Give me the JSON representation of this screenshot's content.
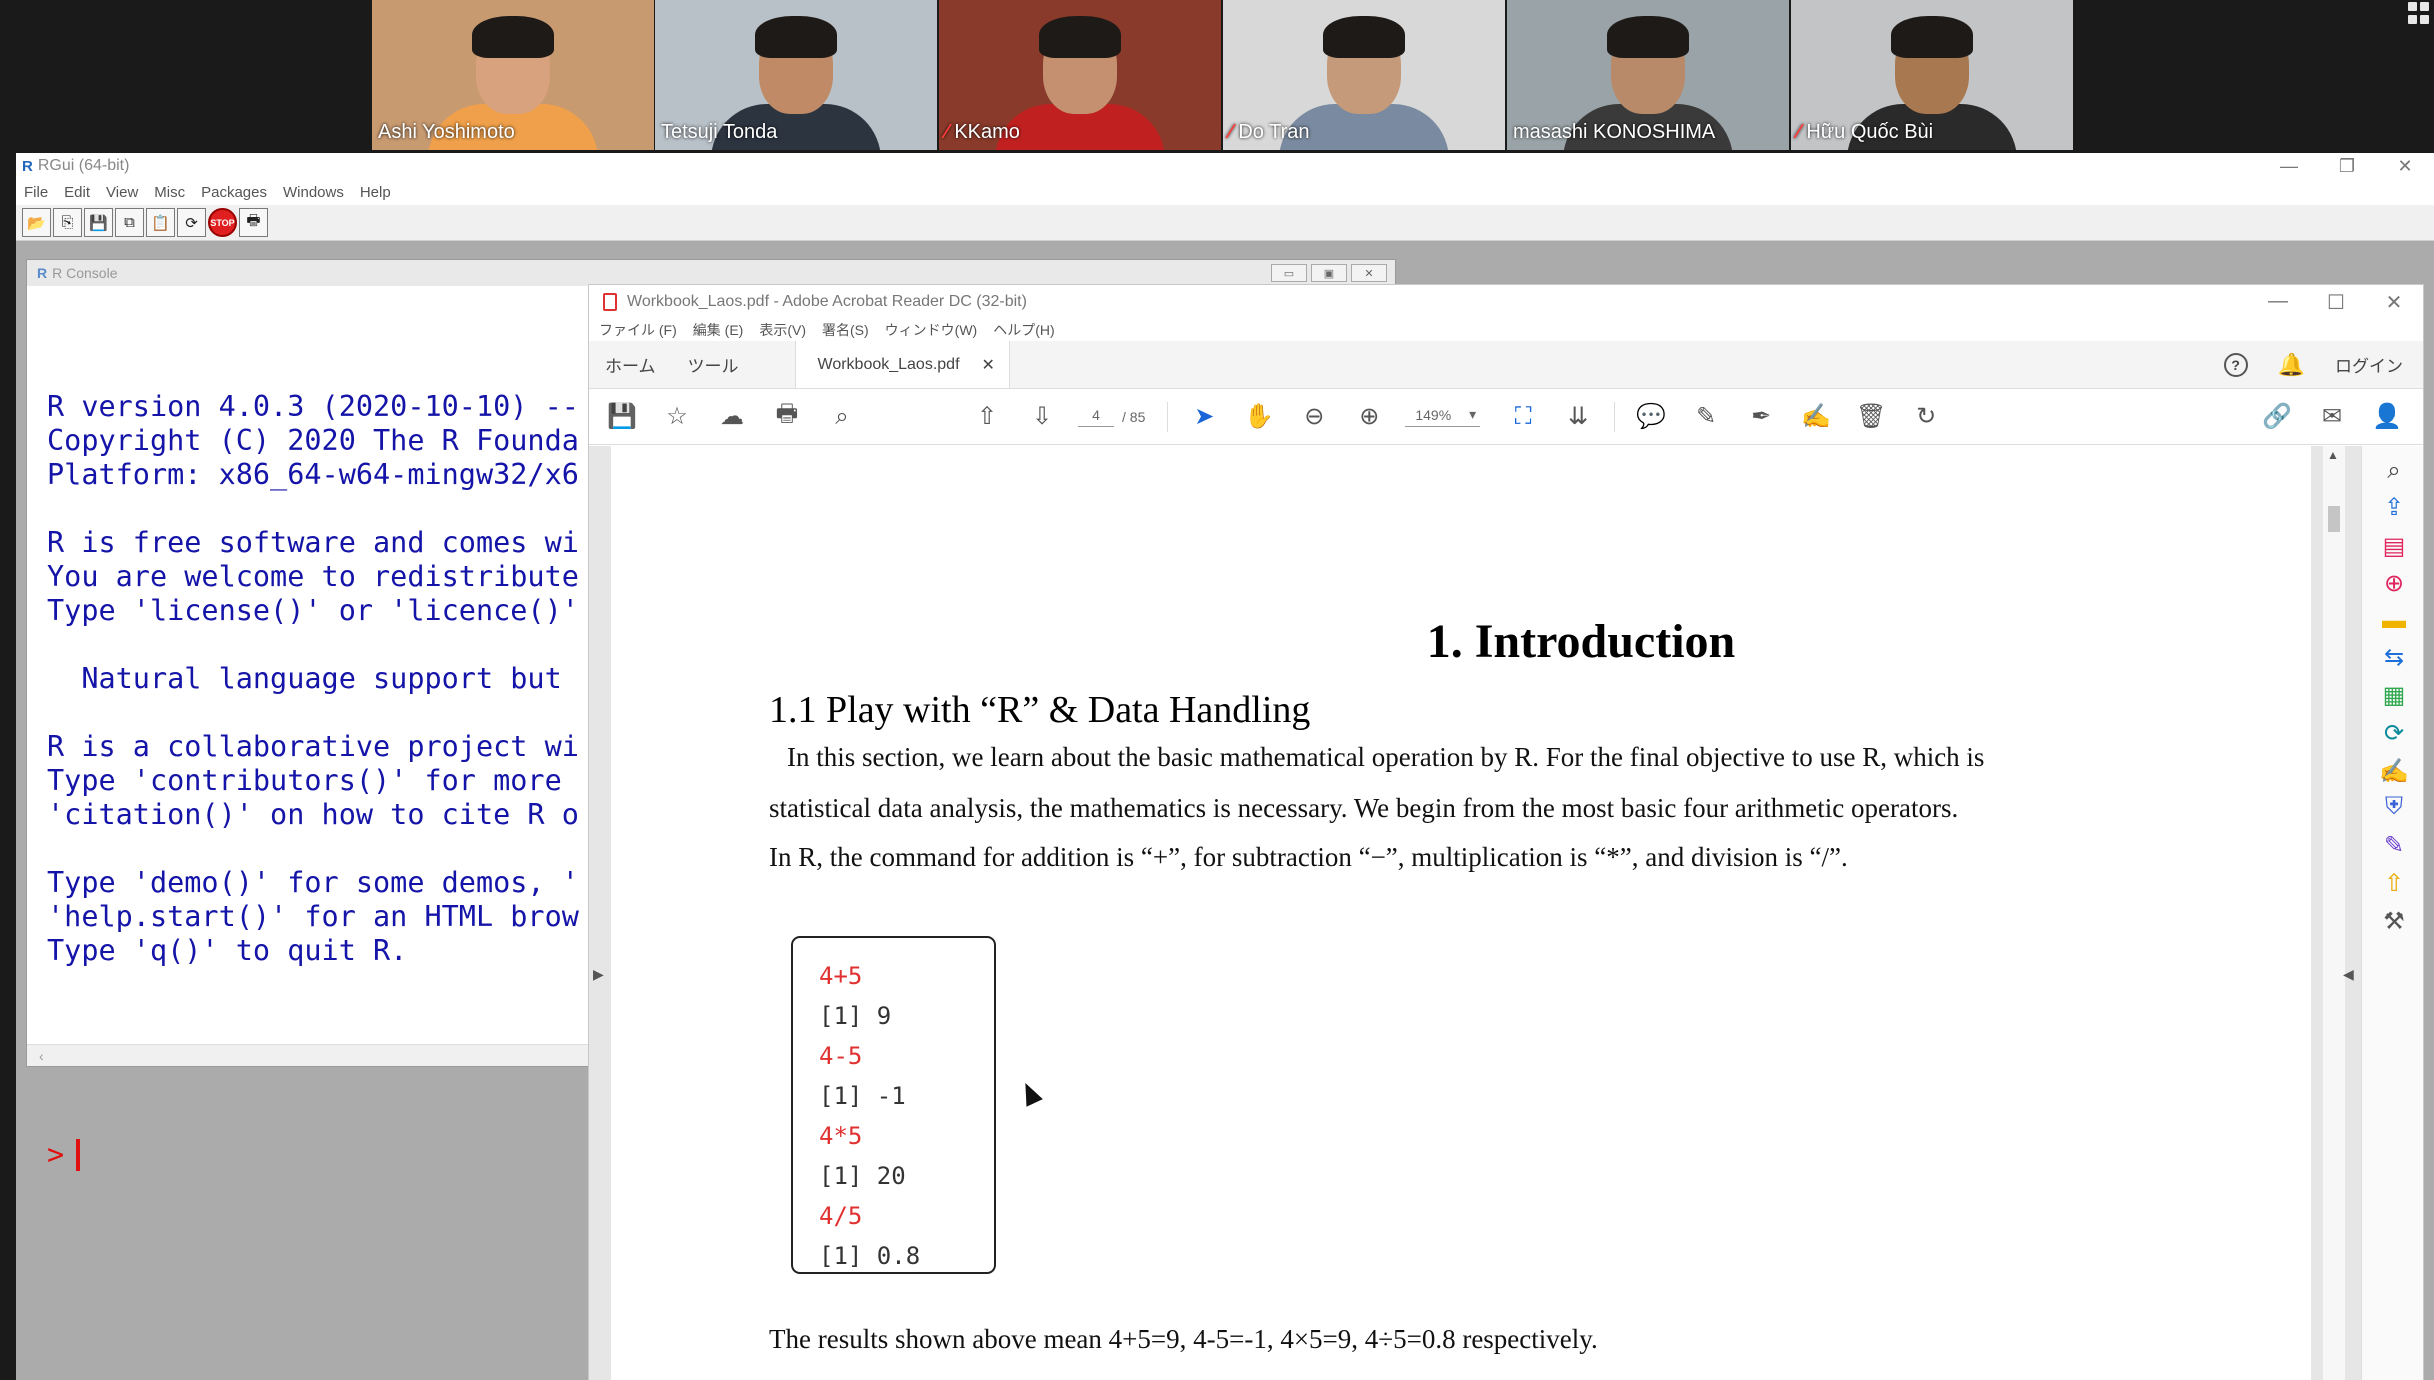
{
  "zoom": {
    "participants": [
      {
        "name": "Ashi Yoshimoto",
        "muted": false,
        "bg": "#c89a70",
        "skin": "#d9a27e",
        "shirt": "#f0a04a"
      },
      {
        "name": "Tetsuji Tonda",
        "muted": false,
        "bg": "#b8c0c8",
        "skin": "#c08a66",
        "shirt": "#2c3440"
      },
      {
        "name": "KKamo",
        "muted": true,
        "bg": "#8a3a2a",
        "skin": "#c49070",
        "shirt": "#c02020"
      },
      {
        "name": "Do Tran",
        "muted": true,
        "bg": "#d8d8d8",
        "skin": "#c49a7a",
        "shirt": "#7a8aa0"
      },
      {
        "name": "masashi KONOSHIMA",
        "muted": false,
        "bg": "#9aa4a8",
        "skin": "#b88a6a",
        "shirt": "#3a3a3a",
        "active": true
      },
      {
        "name": "Hữu Quốc Bùi",
        "muted": true,
        "bg": "#c2c4c6",
        "skin": "#a87850",
        "shirt": "#2a2a2a"
      }
    ]
  },
  "rgui": {
    "title": "RGui (64-bit)",
    "menu": [
      "File",
      "Edit",
      "View",
      "Misc",
      "Packages",
      "Windows",
      "Help"
    ],
    "console": {
      "title": "R Console",
      "lines": [
        "R version 4.0.3 (2020-10-10) --",
        "Copyright (C) 2020 The R Founda",
        "Platform: x86_64-w64-mingw32/x6",
        "",
        "R is free software and comes wi",
        "You are welcome to redistribute",
        "Type 'license()' or 'licence()'",
        "",
        "  Natural language support but",
        "",
        "R is a collaborative project wi",
        "Type 'contributors()' for more",
        "'citation()' on how to cite R o",
        "",
        "Type 'demo()' for some demos, '",
        "'help.start()' for an HTML brow",
        "Type 'q()' to quit R."
      ],
      "prompt": ">"
    }
  },
  "acrobat": {
    "title": "Workbook_Laos.pdf - Adobe Acrobat Reader DC (32-bit)",
    "menu": [
      "ファイル (F)",
      "編集 (E)",
      "表示(V)",
      "署名(S)",
      "ウィンドウ(W)",
      "ヘルプ(H)"
    ],
    "tabs": {
      "home": "ホーム",
      "tools": "ツール",
      "doc": "Workbook_Laos.pdf",
      "login": "ログイン"
    },
    "page_current": "4",
    "page_total": "/ 85",
    "zoom": "149%",
    "content": {
      "h1": "1. Introduction",
      "h2": "1.1  Play with “R” & Data Handling",
      "p1": "In this section, we learn about the basic mathematical operation by R. For the final objective to use R, which is",
      "p2": "statistical data analysis, the mathematics is necessary. We begin from the most basic four arithmetic operators.",
      "p3": "In R, the command for addition is “+”, for subtraction “−”, multiplication is “*”, and division is “/”.",
      "code": [
        {
          "text": "4+5",
          "kind": "cmd"
        },
        {
          "text": "[1]  9",
          "kind": "out"
        },
        {
          "text": "4-5",
          "kind": "cmd"
        },
        {
          "text": "[1]  -1",
          "kind": "out"
        },
        {
          "text": "4*5",
          "kind": "cmd"
        },
        {
          "text": "[1]  20",
          "kind": "out"
        },
        {
          "text": "4/5",
          "kind": "cmd"
        },
        {
          "text": "[1]  0.8",
          "kind": "out"
        }
      ],
      "p4": "The results shown above mean 4+5=9, 4-5=-1, 4×5=9, 4÷5=0.8 respectively."
    }
  }
}
